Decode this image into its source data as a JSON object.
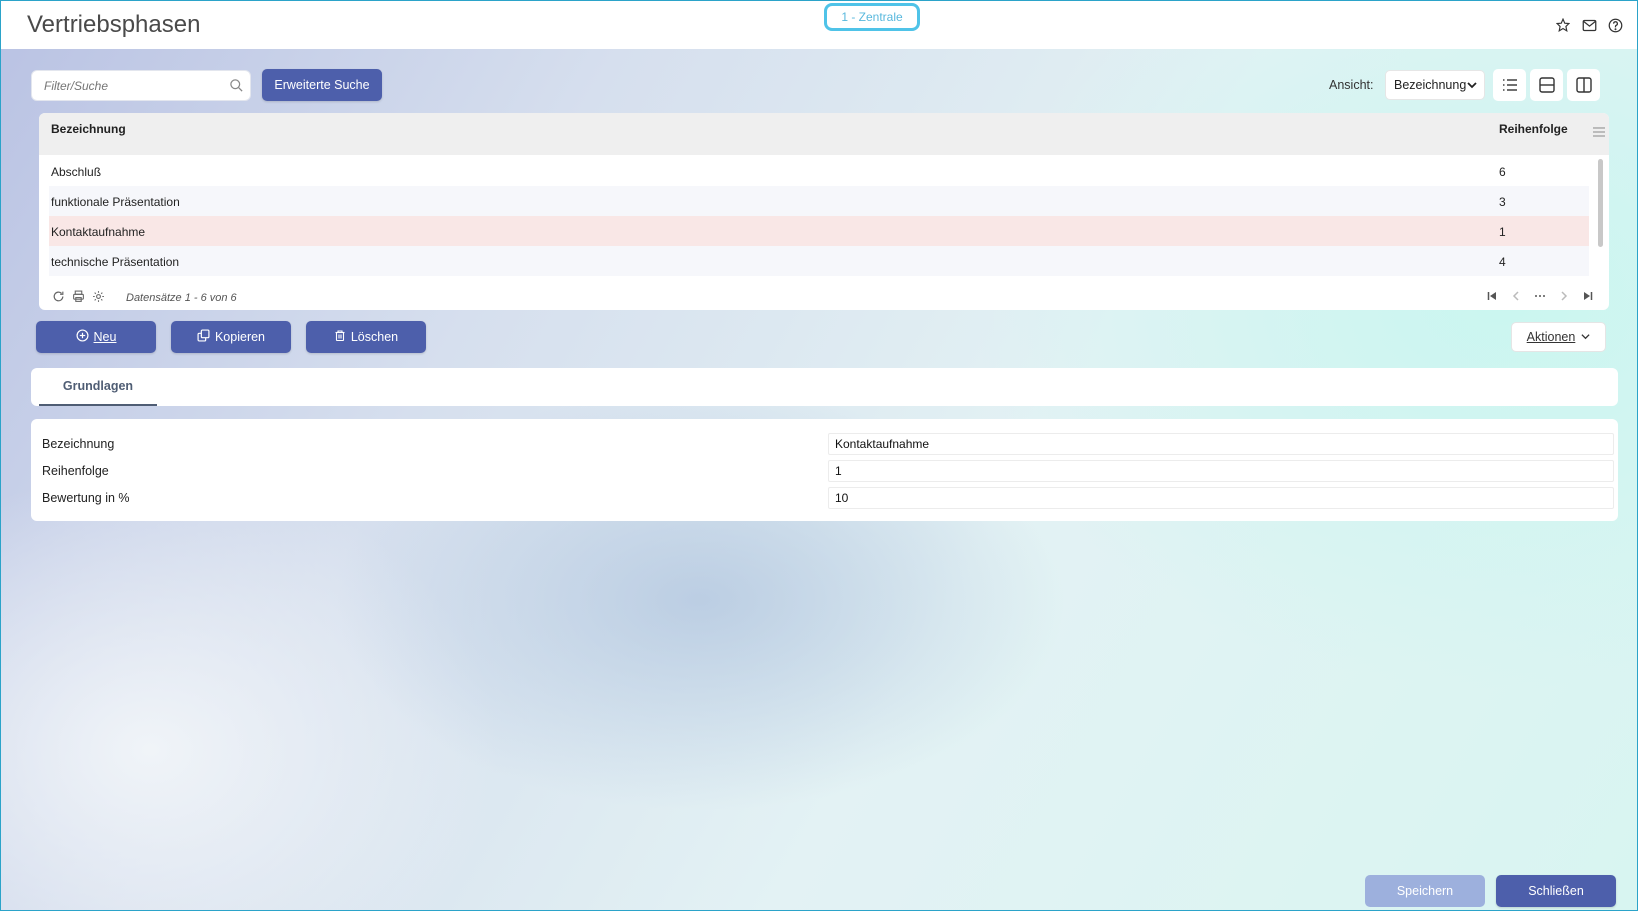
{
  "header": {
    "title": "Vertriebsphasen",
    "branch_badge": "1 - Zentrale",
    "icons": [
      "star-icon",
      "mail-icon",
      "help-icon"
    ]
  },
  "toolbar": {
    "search_placeholder": "Filter/Suche",
    "advanced_search_label": "Erweiterte Suche",
    "view_label": "Ansicht:",
    "view_selected": "Bezeichnung",
    "view_modes": [
      "list-view-icon",
      "split-horizontal-icon",
      "split-vertical-icon"
    ]
  },
  "grid": {
    "columns": [
      "Bezeichnung",
      "Reihenfolge"
    ],
    "rows": [
      {
        "bezeichnung": "Abschluß",
        "reihenfolge": "6"
      },
      {
        "bezeichnung": "funktionale Präsentation",
        "reihenfolge": "3"
      },
      {
        "bezeichnung": "Kontaktaufnahme",
        "reihenfolge": "1"
      },
      {
        "bezeichnung": "technische Präsentation",
        "reihenfolge": "4"
      }
    ],
    "selected_row": "Kontaktaufnahme",
    "record_count": "Datensätze 1 - 6 von 6"
  },
  "actions": {
    "new_label": "Neu",
    "copy_label": "Kopieren",
    "delete_label": "Löschen",
    "more_label": "Aktionen"
  },
  "tabs": {
    "active": "Grundlagen"
  },
  "form": {
    "fields": [
      {
        "label": "Bezeichnung",
        "value": "Kontaktaufnahme"
      },
      {
        "label": "Reihenfolge",
        "value": "1"
      },
      {
        "label": "Bewertung in %",
        "value": "10"
      }
    ]
  },
  "footer": {
    "save_label": "Speichern",
    "close_label": "Schließen"
  },
  "colors": {
    "primary": "#4d5fab",
    "primary_disabled": "#9db0dd",
    "selected_row": "#f9e7e6",
    "badge_border": "#4fc3e8"
  }
}
